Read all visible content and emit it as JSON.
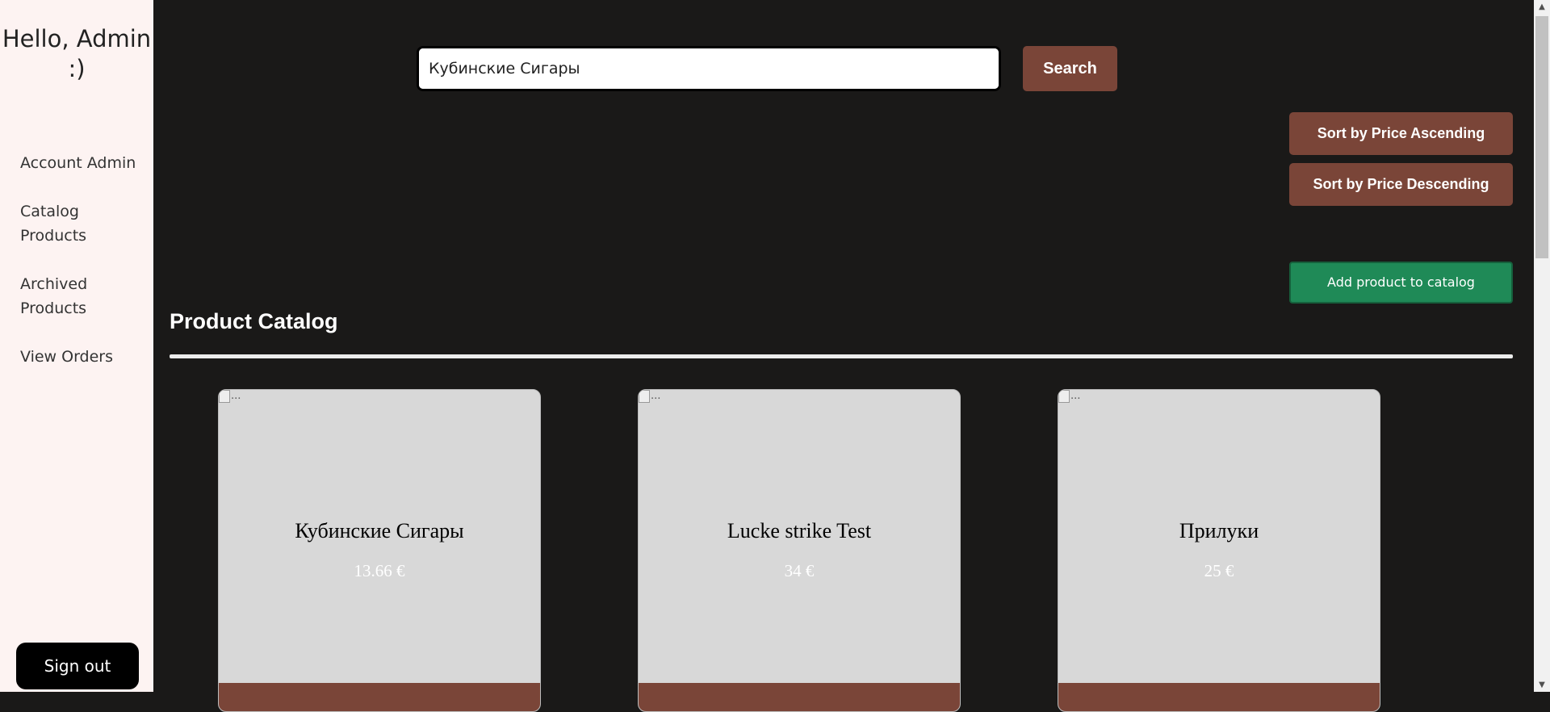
{
  "sidebar": {
    "greeting": "Hello, Admin :)",
    "nav": [
      {
        "label": "Account Admin"
      },
      {
        "label": "Catalog Products"
      },
      {
        "label": "Archived Products"
      },
      {
        "label": "View Orders"
      }
    ],
    "sign_out_label": "Sign out"
  },
  "search": {
    "value": "Кубинские Сигары",
    "button_label": "Search"
  },
  "sort": {
    "ascending_label": "Sort by Price Ascending",
    "descending_label": "Sort by Price Descending"
  },
  "add_product_label": "Add product to catalog",
  "catalog": {
    "title": "Product Catalog",
    "img_alt": "...",
    "products": [
      {
        "name": "Кубинские Сигары",
        "price": "13.66 €"
      },
      {
        "name": "Lucke strike Test",
        "price": "34 €"
      },
      {
        "name": "Прилуки",
        "price": "25 €"
      }
    ]
  },
  "colors": {
    "accent_brown": "#7a4538",
    "add_green": "#1f8a57",
    "main_bg": "#1a1918",
    "sidebar_bg": "#fdf3f2"
  },
  "icons": {
    "scroll_up": "scroll-up-arrow-icon",
    "scroll_down": "scroll-down-arrow-icon",
    "broken_image": "broken-image-icon"
  }
}
